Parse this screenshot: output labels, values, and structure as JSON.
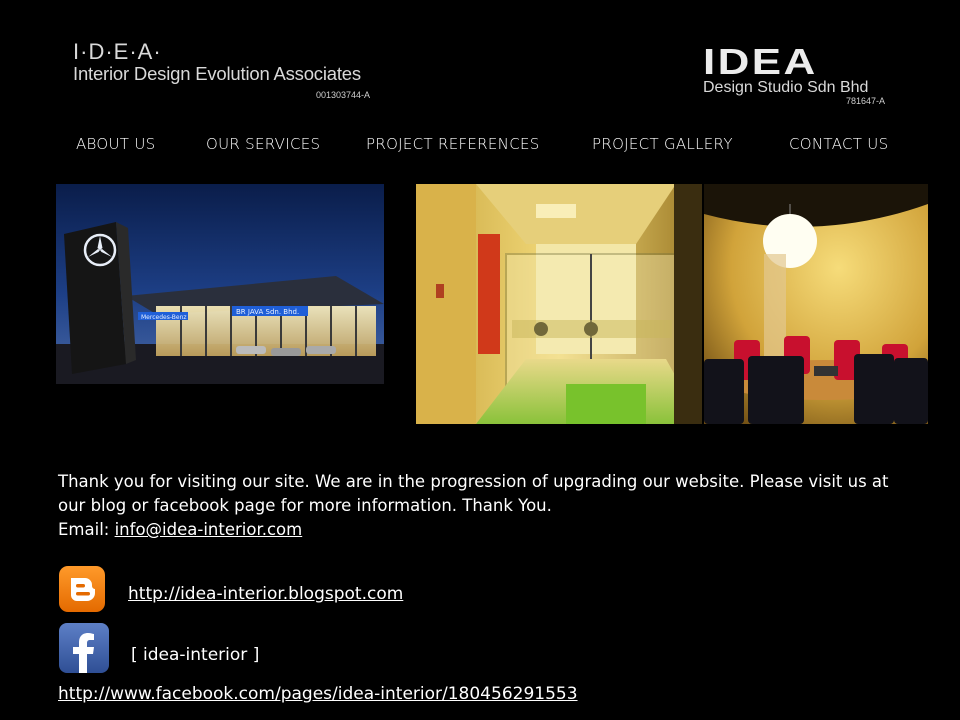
{
  "header": {
    "left_logo": {
      "mark": "I·D·E·A·",
      "full_name": "Interior Design Evolution Associates",
      "reg_no": "001303744-A"
    },
    "right_logo": {
      "mark": "IDEA",
      "subtitle": "Design Studio Sdn Bhd",
      "reg_no": "781647-A"
    }
  },
  "nav": {
    "items": [
      {
        "label": "ABOUT US"
      },
      {
        "label": "OUR SERVICES"
      },
      {
        "label": "PROJECT REFERENCES"
      },
      {
        "label": "PROJECT GALLERY"
      },
      {
        "label": "CONTACT US"
      }
    ]
  },
  "photos": {
    "showroom": {
      "sign_text": "BR JAVA Sdn. Bhd.",
      "brand_text": "Mercedes-Benz"
    }
  },
  "main": {
    "intro_line1": "Thank you for visiting our site. We are in the progression of upgrading our website. Please visit us at our blog or facebook page for more information. Thank You.",
    "email_label": "Email:",
    "email_link": "info@idea-interior.com"
  },
  "social": {
    "blogger_icon": "blogger-icon",
    "blog_link": "http://idea-interior.blogspot.com",
    "facebook_icon": "facebook-icon",
    "facebook_label": "[ idea-interior ]",
    "facebook_link": "http://www.facebook.com/pages/idea-interior/180456291553"
  },
  "colors": {
    "background": "#000000",
    "text": "#ffffff",
    "blogger_orange": "#f57d00",
    "facebook_blue": "#3b5998"
  }
}
